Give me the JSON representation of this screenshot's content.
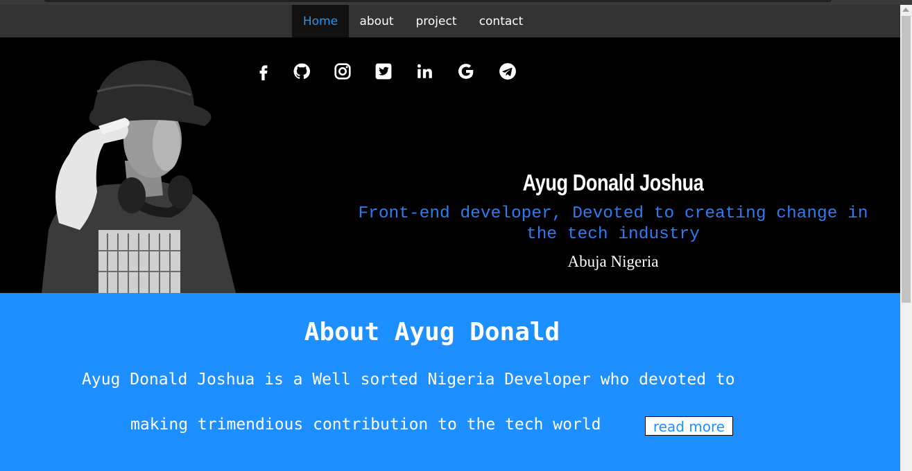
{
  "nav": {
    "items": [
      {
        "label": "Home",
        "active": true
      },
      {
        "label": "about",
        "active": false
      },
      {
        "label": "project",
        "active": false
      },
      {
        "label": "contact",
        "active": false
      }
    ],
    "active_color": "#2196f3"
  },
  "hero": {
    "social_icons": [
      "facebook-icon",
      "github-icon",
      "instagram-icon",
      "twitter-icon",
      "linkedin-icon",
      "google-icon",
      "telegram-icon"
    ],
    "name": "Ayug Donald Joshua",
    "tagline": "Front-end developer, Devoted to creating change in the tech industry",
    "location": "Abuja Nigeria"
  },
  "about": {
    "title": "About Ayug Donald",
    "line1": "Ayug Donald Joshua is a Well sorted Nigeria Developer who devoted to",
    "line2": "making trimendious contribution to the tech world",
    "read_more": "read more",
    "background_color": "#1e8fff"
  }
}
